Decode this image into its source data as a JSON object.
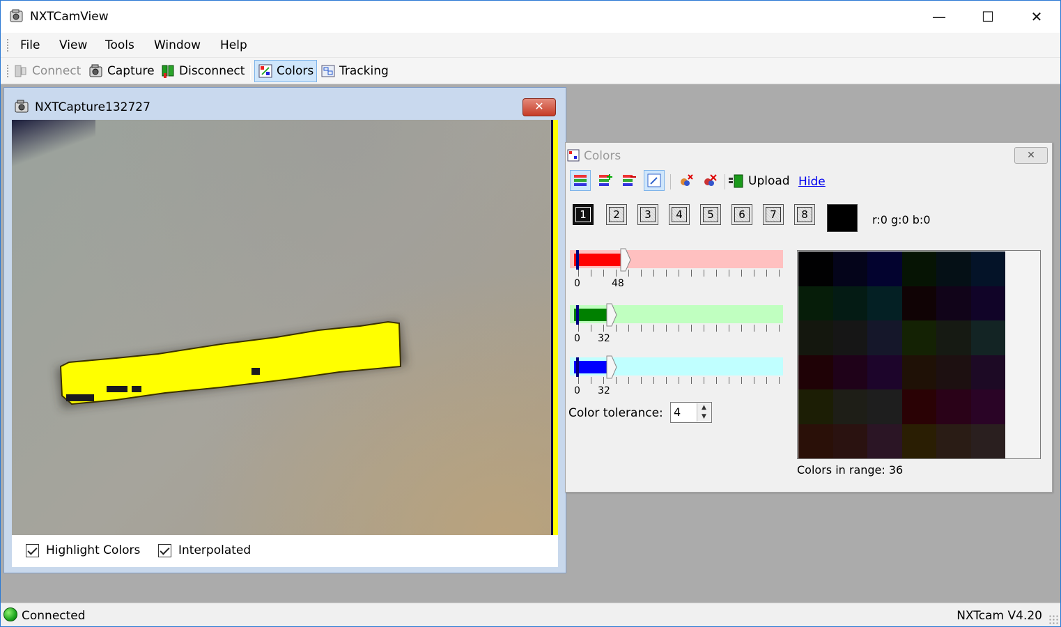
{
  "window": {
    "title": "NXTCamView",
    "min_glyph": "—",
    "max_glyph": "☐",
    "close_glyph": "✕"
  },
  "menu": [
    "File",
    "View",
    "Tools",
    "Window",
    "Help"
  ],
  "toolbar": {
    "connect": "Connect",
    "capture": "Capture",
    "disconnect": "Disconnect",
    "colors": "Colors",
    "tracking": "Tracking"
  },
  "capture_window": {
    "title": "NXTCapture132727",
    "close_glyph": "✕",
    "highlight_label": "Highlight Colors",
    "highlight_checked": true,
    "interpolated_label": "Interpolated",
    "interpolated_checked": true
  },
  "colors_window": {
    "title": "Colors",
    "close_glyph": "✕",
    "upload": "Upload",
    "hide": "Hide",
    "slots": [
      "1",
      "2",
      "3",
      "4",
      "5",
      "6",
      "7",
      "8"
    ],
    "active_slot": "1",
    "rgb": "r:0 g:0 b:0",
    "sliders": [
      {
        "name": "red",
        "min_label": "0",
        "value": "48",
        "fill": "#ff0000",
        "track": "#ffc0c0"
      },
      {
        "name": "green",
        "min_label": "0",
        "value": "32",
        "fill": "#008000",
        "track": "#c0ffc0"
      },
      {
        "name": "blue",
        "min_label": "0",
        "value": "32",
        "fill": "#0000ff",
        "track": "#c0ffff"
      }
    ],
    "tolerance_label": "Color tolerance:",
    "tolerance_value": "4",
    "range_label": "Colors in range: 36",
    "palette": [
      "#010102",
      "#04041a",
      "#03032f",
      "#061404",
      "#051016",
      "#041328",
      "#061d09",
      "#041b14",
      "#042024",
      "#100305",
      "#110419",
      "#110428",
      "#14170e",
      "#161616",
      "#15172a",
      "#142204",
      "#161a13",
      "#132424",
      "#1f0206",
      "#1f0219",
      "#1d052b",
      "#1f1106",
      "#1d1011",
      "#1d0a25",
      "#1c1e05",
      "#1e1e17",
      "#1e1e1e",
      "#2a0205",
      "#2a0218",
      "#2a0426",
      "#2a1008",
      "#2a1210",
      "#2b1525",
      "#2a1e03",
      "#2a1c15",
      "#2a1f1f"
    ]
  },
  "status": {
    "text": "Connected",
    "version": "NXTcam V4.20"
  }
}
